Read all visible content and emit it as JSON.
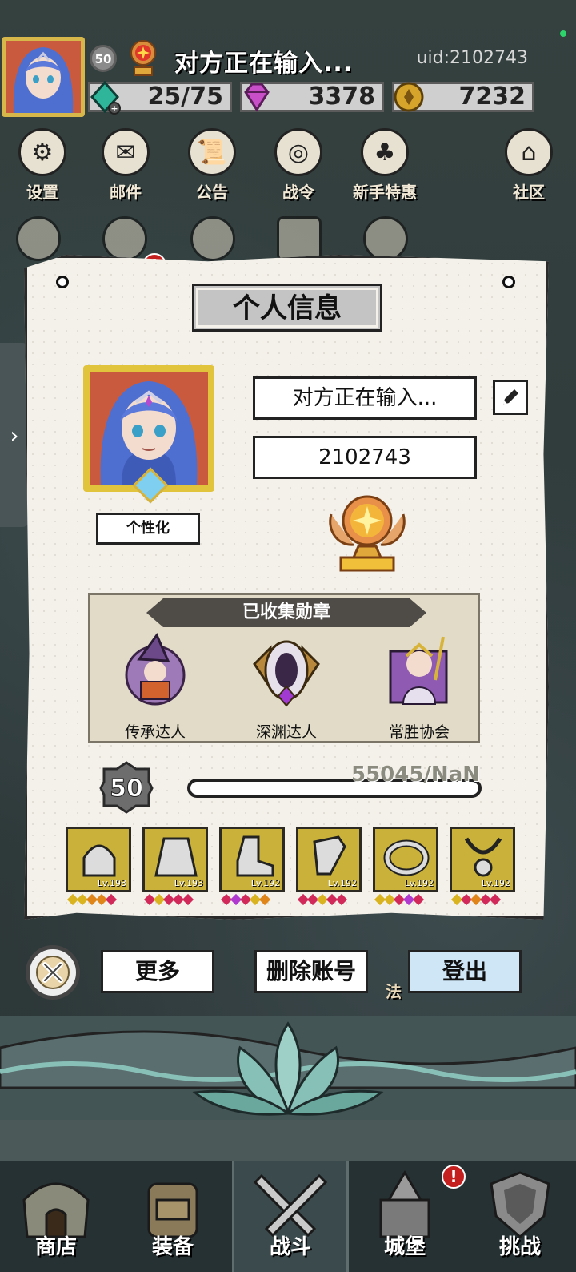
{
  "header": {
    "player_name": "对方正在输入...",
    "uid": "uid:2102743",
    "level": "50",
    "energy": "25/75",
    "gems": "3378",
    "gold": "7232"
  },
  "icon_row": [
    {
      "label": "设置",
      "icon": "gear-icon"
    },
    {
      "label": "邮件",
      "icon": "mail-icon",
      "badge": "!"
    },
    {
      "label": "公告",
      "icon": "scroll-icon"
    },
    {
      "label": "战令",
      "icon": "crystal-ball-icon"
    },
    {
      "label": "新手特惠",
      "icon": "gift-bag-icon"
    },
    {
      "label": "社区",
      "icon": "home-icon"
    }
  ],
  "modal": {
    "title": "个人信息",
    "name_field": "对方正在输入...",
    "id_field": "2102743",
    "personalize_button": "个性化",
    "medals_title": "已收集勋章",
    "medals": [
      {
        "name": "传承达人",
        "icon": "witch-medal-icon"
      },
      {
        "name": "深渊达人",
        "icon": "abyss-medal-icon"
      },
      {
        "name": "常胜协会",
        "icon": "priestess-medal-icon"
      }
    ],
    "level": "50",
    "xp": "55045/NaN",
    "xp_progress": 0,
    "equipment": [
      {
        "lv": "Lv.193",
        "icon": "helmet-icon",
        "stars": [
          "#d9b320",
          "#d9b320",
          "#e0851a",
          "#e0851a",
          "#d12a5a"
        ]
      },
      {
        "lv": "Lv.193",
        "icon": "cape-icon",
        "stars": [
          "#d12a5a",
          "#d9b320",
          "#d12a5a",
          "#d12a5a",
          "#d12a5a"
        ]
      },
      {
        "lv": "Lv.192",
        "icon": "boot-icon",
        "stars": [
          "#d12a5a",
          "#b03ad0",
          "#d12a5a",
          "#d9b320",
          "#e0851a"
        ]
      },
      {
        "lv": "Lv.192",
        "icon": "gauntlet-icon",
        "stars": [
          "#d12a5a",
          "#d12a5a",
          "#d9b320",
          "#d12a5a",
          "#d12a5a"
        ]
      },
      {
        "lv": "Lv.192",
        "icon": "ring-icon",
        "stars": [
          "#d9b320",
          "#d9b320",
          "#d12a5a",
          "#b03ad0",
          "#d12a5a"
        ]
      },
      {
        "lv": "Lv.192",
        "icon": "necklace-icon",
        "stars": [
          "#d9b320",
          "#d12a5a",
          "#e0851a",
          "#d12a5a",
          "#d12a5a"
        ]
      }
    ],
    "buttons": {
      "more": "更多",
      "delete": "删除账号",
      "logout": "登出"
    }
  },
  "side_label": "法",
  "bottom_nav": [
    {
      "label": "商店",
      "icon": "shop-icon"
    },
    {
      "label": "装备",
      "icon": "backpack-icon"
    },
    {
      "label": "战斗",
      "icon": "crossed-swords-icon",
      "active": true
    },
    {
      "label": "城堡",
      "icon": "castle-icon",
      "badge": "!"
    },
    {
      "label": "挑战",
      "icon": "shield-icon"
    }
  ],
  "colors": {
    "paper": "#f4f1ea",
    "logout_button": "#cfe6f7",
    "gold_frame": "#e1c33c",
    "notification": "#c42020"
  }
}
